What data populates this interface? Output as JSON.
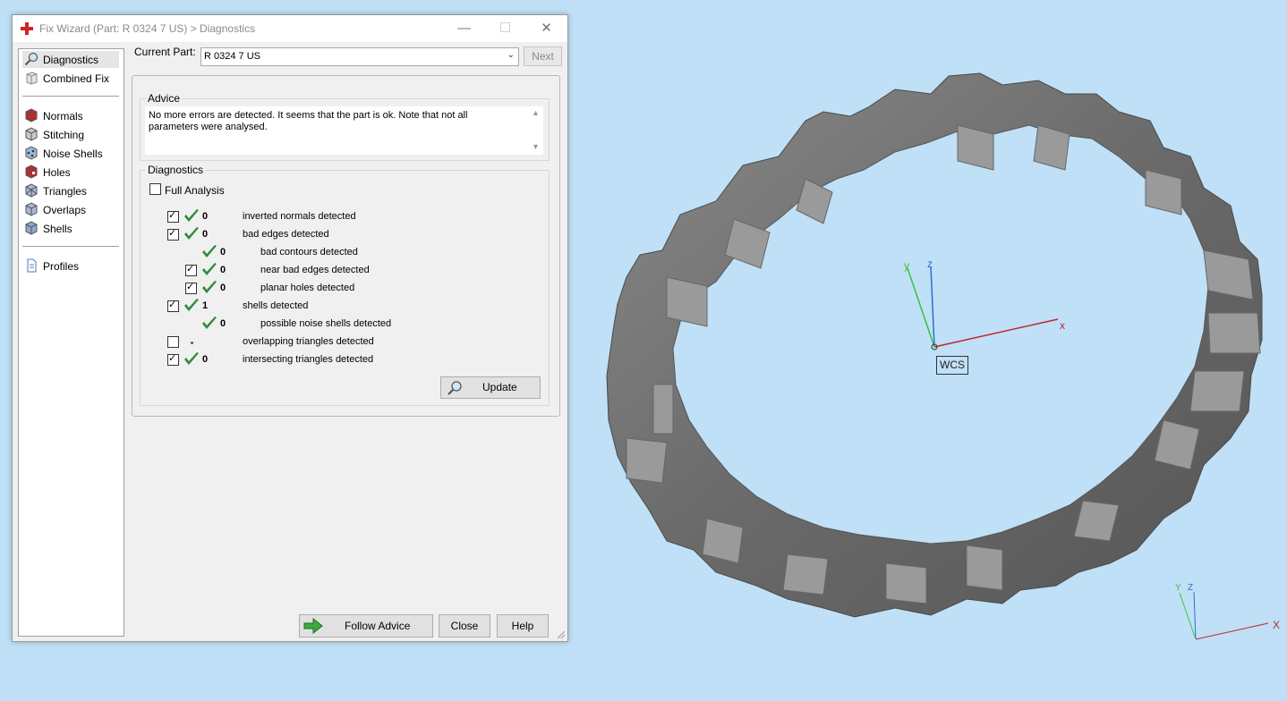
{
  "window": {
    "title": "Fix Wizard (Part: R 0324 7 US) > Diagnostics",
    "controls": [
      "—",
      "☐",
      "✕"
    ]
  },
  "sidebar": {
    "items": [
      {
        "label": "Diagnostics",
        "icon": "magnifier-icon",
        "selected": true
      },
      {
        "label": "Combined Fix",
        "icon": "combined-fix-icon"
      },
      {
        "label": "Normals",
        "icon": "normals-cube-icon"
      },
      {
        "label": "Stitching",
        "icon": "stitching-cube-icon"
      },
      {
        "label": "Noise Shells",
        "icon": "noise-shells-icon"
      },
      {
        "label": "Holes",
        "icon": "holes-cube-icon"
      },
      {
        "label": "Triangles",
        "icon": "triangles-cube-icon"
      },
      {
        "label": "Overlaps",
        "icon": "overlaps-cube-icon"
      },
      {
        "label": "Shells",
        "icon": "shells-cube-icon"
      },
      {
        "label": "Profiles",
        "icon": "profiles-document-icon"
      }
    ]
  },
  "current_part": {
    "label": "Current Part:",
    "value": "R 0324 7 US",
    "next_label": "Next"
  },
  "advice": {
    "legend": "Advice",
    "text": "No more errors are detected. It seems that the part is ok. Note that not all parameters were analysed."
  },
  "diagnostics": {
    "legend": "Diagnostics",
    "full_analysis_label": "Full Analysis",
    "full_analysis_checked": false,
    "rows": [
      {
        "checkbox": true,
        "checked": true,
        "status": "check",
        "count": "0",
        "label": "inverted normals detected",
        "indent": 0
      },
      {
        "checkbox": true,
        "checked": true,
        "status": "check",
        "count": "0",
        "label": "bad edges detected",
        "indent": 0
      },
      {
        "checkbox": false,
        "checked": false,
        "status": "check",
        "count": "0",
        "label": "bad contours detected",
        "indent": 1
      },
      {
        "checkbox": true,
        "checked": true,
        "status": "check",
        "count": "0",
        "label": "near bad edges detected",
        "indent": 1
      },
      {
        "checkbox": true,
        "checked": true,
        "status": "check",
        "count": "0",
        "label": "planar holes detected",
        "indent": 1
      },
      {
        "checkbox": true,
        "checked": true,
        "status": "check",
        "count": "1",
        "label": "shells detected",
        "indent": 0
      },
      {
        "checkbox": false,
        "checked": false,
        "status": "check",
        "count": "0",
        "label": "possible noise shells detected",
        "indent": 1
      },
      {
        "checkbox": true,
        "checked": false,
        "status": "dot",
        "count": "",
        "label": "overlapping triangles detected",
        "indent": 0
      },
      {
        "checkbox": true,
        "checked": true,
        "status": "check",
        "count": "0",
        "label": "intersecting triangles detected",
        "indent": 0
      }
    ],
    "update_label": "Update"
  },
  "footer": {
    "follow_advice_label": "Follow Advice",
    "close_label": "Close",
    "help_label": "Help"
  },
  "viewport": {
    "wcs_label": "WCS",
    "axis_x": "x",
    "axis_y": "y",
    "axis_z": "z",
    "mini_axis_x": "X",
    "mini_axis_y": "Y",
    "mini_axis_z": "Z",
    "colors": {
      "background": "#bfe0f7",
      "x_axis": "#c0282c",
      "y_axis": "#3fbf3f",
      "z_axis": "#2f6fd1"
    }
  },
  "colors": {
    "accent_check": "#2e8b3a",
    "app_icon": "#d42121"
  }
}
